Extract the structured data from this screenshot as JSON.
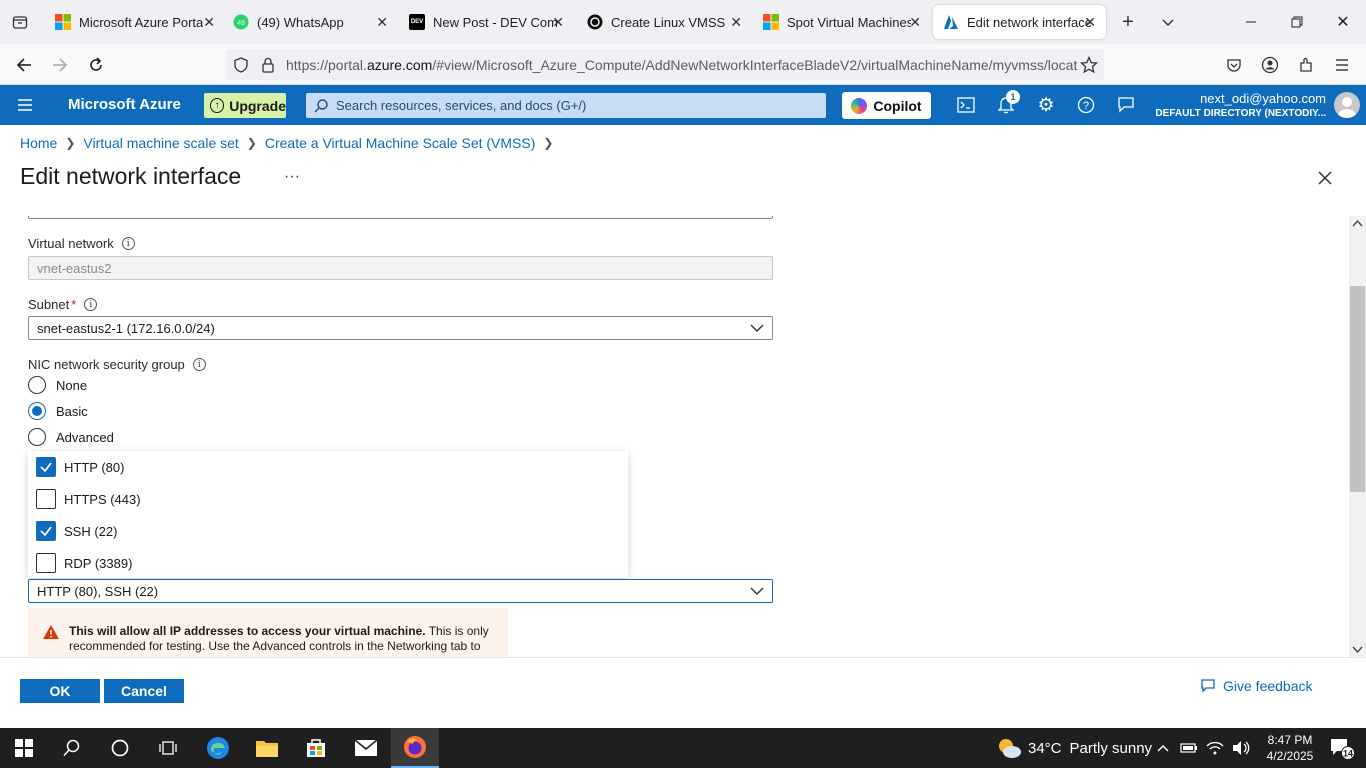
{
  "browser": {
    "tabs": [
      {
        "title": "Microsoft Azure Portal",
        "icon": "microsoft-logo-icon"
      },
      {
        "title": "(49) WhatsApp",
        "icon": "whatsapp-icon",
        "badge": "49"
      },
      {
        "title": "New Post - DEV Comm",
        "icon": "dev-logo-icon",
        "logo_text": "DEV"
      },
      {
        "title": "Create Linux VMSS",
        "icon": "chatgpt-icon"
      },
      {
        "title": "Spot Virtual Machines",
        "icon": "microsoft-logo-icon"
      },
      {
        "title": "Edit network interface",
        "icon": "azure-logo-icon",
        "active": true
      }
    ],
    "url_prefix": "https://portal.",
    "url_domain": "azure.com",
    "url_rest": "/#view/Microsoft_Azure_Compute/AddNewNetworkInterfaceBladeV2/virtualMachineName/myvmss/locat"
  },
  "azure": {
    "brand": "Microsoft Azure",
    "upgrade_label": "Upgrade",
    "search_placeholder": "Search resources, services, and docs (G+/)",
    "copilot_label": "Copilot",
    "notification_count": "1",
    "user_email": "next_odi@yahoo.com",
    "user_directory": "DEFAULT DIRECTORY (NEXTODIY..."
  },
  "breadcrumb": [
    "Home",
    "Virtual machine scale set",
    "Create a Virtual Machine Scale Set (VMSS)"
  ],
  "page": {
    "title": "Edit network interface",
    "more_label": "···"
  },
  "form": {
    "vnet_label": "Virtual network",
    "vnet_value": "vnet-eastus2",
    "subnet_label": "Subnet",
    "subnet_required": "*",
    "subnet_value": "snet-eastus2-1 (172.16.0.0/24)",
    "nsg_label": "NIC network security group",
    "nsg_options": [
      {
        "label": "None",
        "selected": false
      },
      {
        "label": "Basic",
        "selected": true
      },
      {
        "label": "Advanced",
        "selected": false
      }
    ],
    "ports_options": [
      {
        "label": "HTTP (80)",
        "checked": true
      },
      {
        "label": "HTTPS (443)",
        "checked": false
      },
      {
        "label": "SSH (22)",
        "checked": true
      },
      {
        "label": "RDP (3389)",
        "checked": false
      }
    ],
    "ports_value": "HTTP (80), SSH (22)",
    "warning_bold": "This will allow all IP addresses to access your virtual machine.",
    "warning_text": " This is only recommended for testing.  Use the Advanced controls in the Networking tab to"
  },
  "footer": {
    "ok_label": "OK",
    "cancel_label": "Cancel",
    "feedback_label": "Give feedback"
  },
  "taskbar": {
    "temperature": "34°C",
    "weather": "Partly sunny",
    "time": "8:47 PM",
    "date": "4/2/2025",
    "notification_count": "14"
  },
  "colors": {
    "azure_blue": "#0f6cbd",
    "upgrade_green": "#d6f1a8",
    "warning_bg": "#fdf3ec",
    "warning_icon": "#d83b01"
  }
}
